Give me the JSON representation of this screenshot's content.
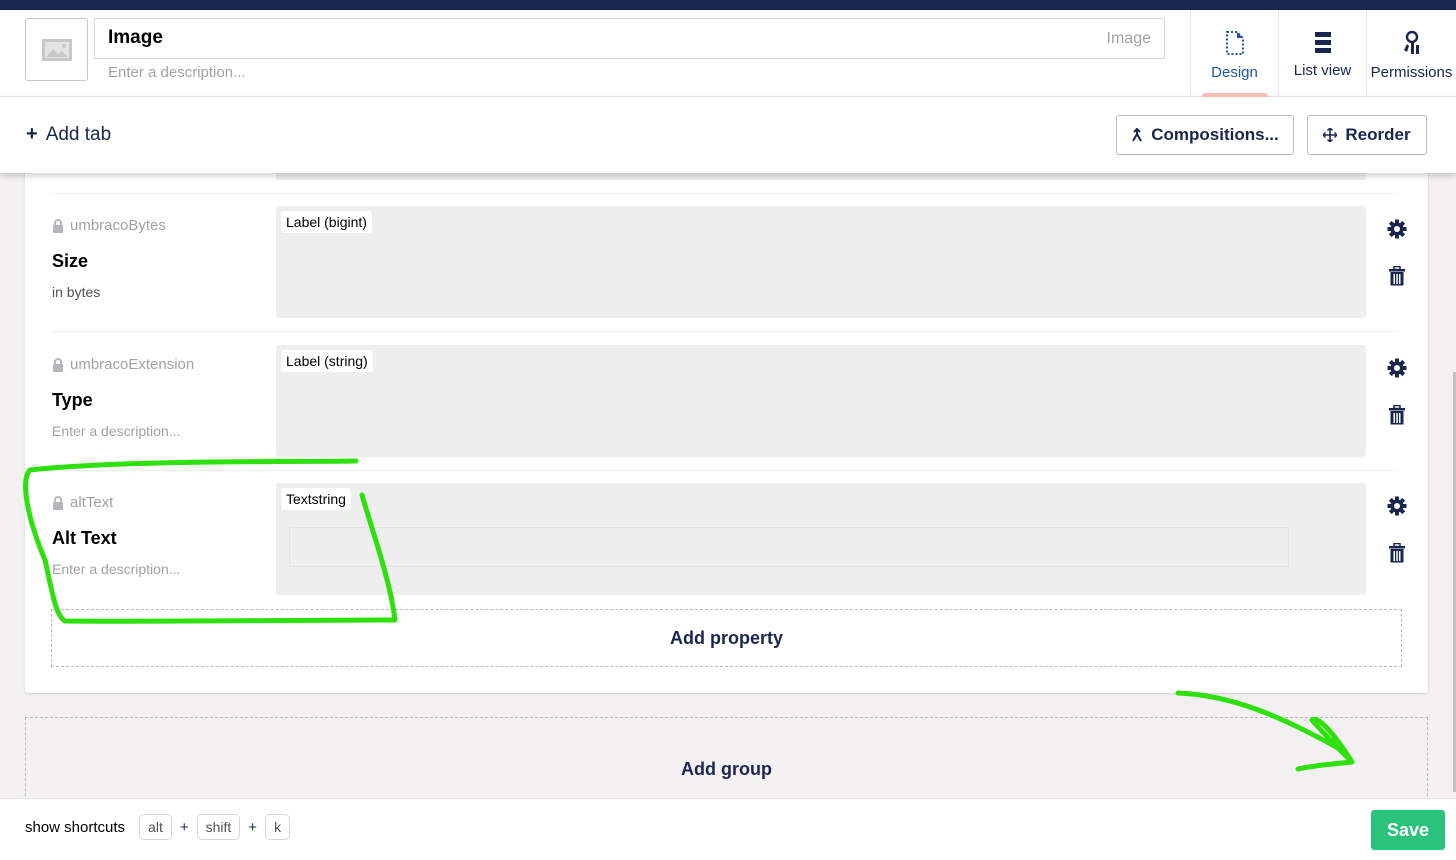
{
  "header": {
    "name_value": "Image",
    "alias": "Image",
    "description_placeholder": "Enter a description...",
    "icon": "picture-icon"
  },
  "apps": [
    {
      "label": "Design",
      "icon": "document-dashed-icon",
      "active": true
    },
    {
      "label": "List view",
      "icon": "list-icon",
      "active": false
    },
    {
      "label": "Permissions",
      "icon": "keys-icon",
      "active": false
    }
  ],
  "toolbar": {
    "add_tab_label": "Add tab",
    "compositions_label": "Compositions...",
    "reorder_label": "Reorder"
  },
  "properties": [
    {
      "alias": "umbracoBytes",
      "label": "Size",
      "description": "in bytes",
      "description_is_placeholder": false,
      "editor": "Label (bigint)"
    },
    {
      "alias": "umbracoExtension",
      "label": "Type",
      "description": "Enter a description...",
      "description_is_placeholder": true,
      "editor": "Label (string)"
    },
    {
      "alias": "altText",
      "label": "Alt Text",
      "description": "Enter a description...",
      "description_is_placeholder": true,
      "editor": "Textstring"
    }
  ],
  "group": {
    "add_property_label": "Add property"
  },
  "add_group_label": "Add group",
  "footer": {
    "shortcuts_label": "show shortcuts",
    "keys": [
      "alt",
      "shift",
      "k"
    ],
    "plus": "+",
    "save_label": "Save"
  },
  "colors": {
    "brand_navy": "#1b264f",
    "save_green": "#2bc37c",
    "active_tab_indicator": "#f5c1bc",
    "annotation_green": "#2ee00e"
  }
}
